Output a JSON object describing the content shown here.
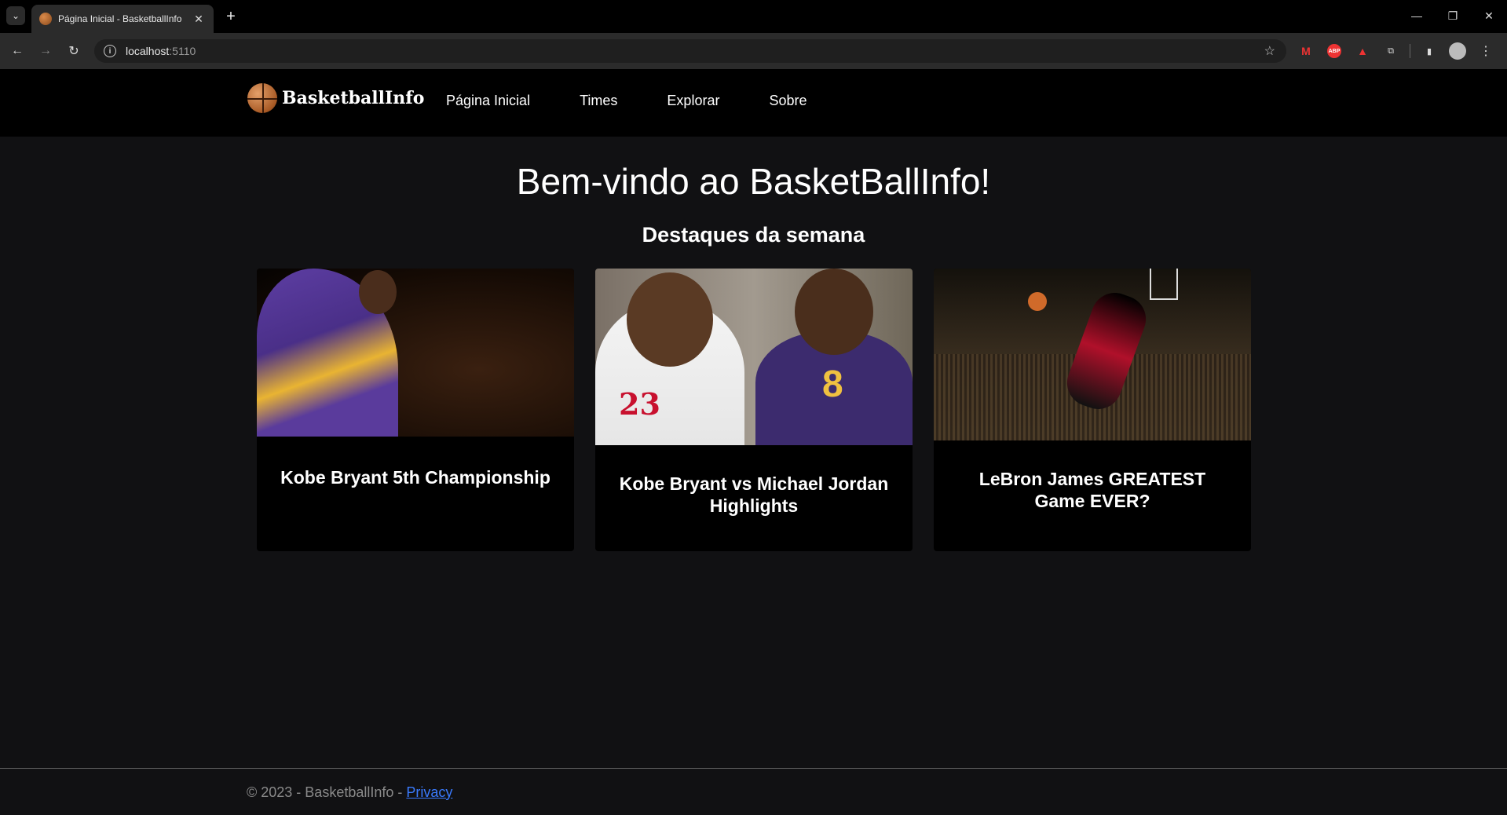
{
  "browser": {
    "tab_title": "Página Inicial - BasketballInfo",
    "url_host": "localhost",
    "url_port": ":5110"
  },
  "site": {
    "brand": "BasketballInfo",
    "nav": [
      "Página Inicial",
      "Times",
      "Explorar",
      "Sobre"
    ]
  },
  "main": {
    "heading": "Bem-vindo ao BasketBallInfo!",
    "subheading": "Destaques da semana",
    "cards": [
      {
        "title": "Kobe Bryant 5th Championship"
      },
      {
        "title": "Kobe Bryant vs Michael Jordan Highlights"
      },
      {
        "title": "LeBron James GREATEST Game EVER?"
      }
    ]
  },
  "footer": {
    "text": "© 2023 - BasketballInfo - ",
    "link": "Privacy"
  }
}
